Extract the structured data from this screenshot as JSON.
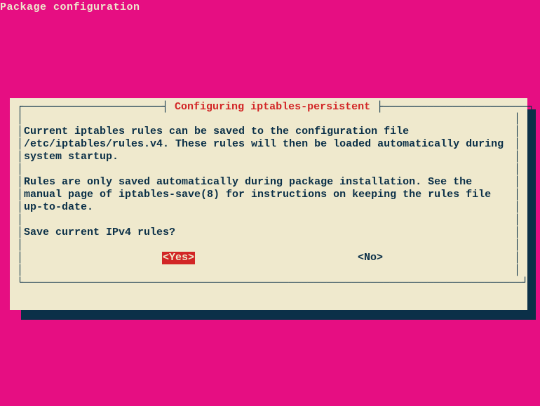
{
  "header": {
    "title": "Package configuration"
  },
  "dialog": {
    "title": " Configuring iptables-persistent ",
    "lines": {
      "l1": "Current iptables rules can be saved to the configuration file",
      "l2": "/etc/iptables/rules.v4. These rules will then be loaded automatically during",
      "l3": "system startup.",
      "l4": "Rules are only saved automatically during package installation. See the",
      "l5": "manual page of iptables-save(8) for instructions on keeping the rules file",
      "l6": "up-to-date.",
      "l7": "Save current IPv4 rules?"
    },
    "buttons": {
      "yes": "<Yes>",
      "no": "<No>"
    }
  }
}
